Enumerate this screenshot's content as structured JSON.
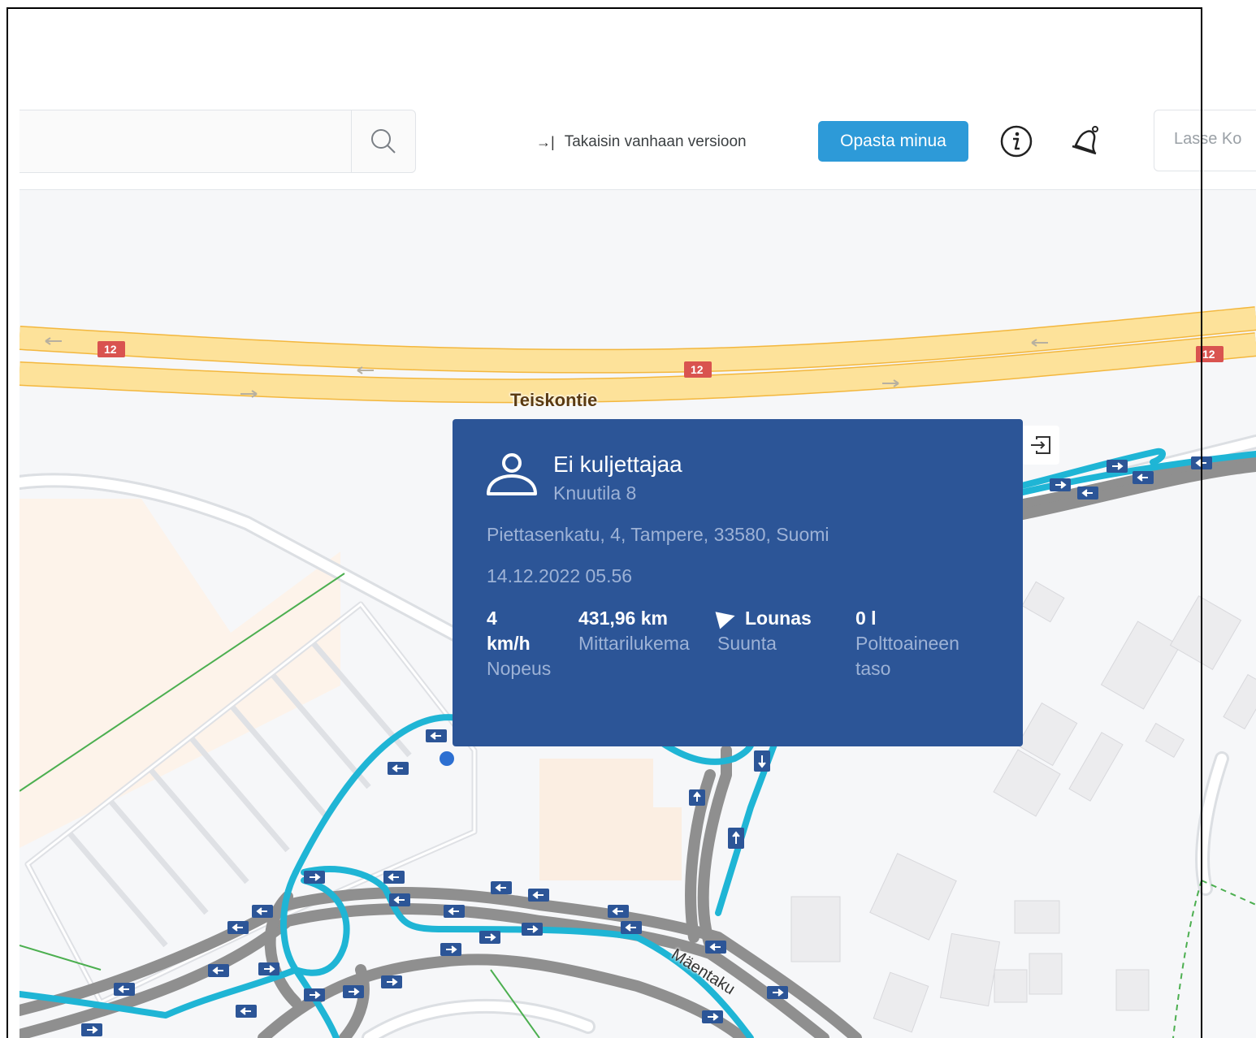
{
  "toolbar": {
    "back_link": "Takaisin vanhaan versioon",
    "guide_button": "Opasta minua",
    "user_name": "Lasse Ko"
  },
  "map": {
    "road_name": "Teiskontie",
    "road_number": "12",
    "street_name": "Mäentaku"
  },
  "popup": {
    "driver": "Ei kuljettajaa",
    "vehicle": "Knuutila 8",
    "address": "Piettasenkatu, 4, Tampere, 33580, Suomi",
    "datetime": "14.12.2022 05.56",
    "stats": [
      {
        "value": "4 km/h",
        "label": "Nopeus"
      },
      {
        "value": "431,96 km",
        "label": "Mittarilukema"
      },
      {
        "value": "Lounas",
        "label": "Suunta",
        "icon": "direction-arrow-icon"
      },
      {
        "value": "0 l",
        "label": "Polttoaineen taso"
      }
    ]
  },
  "colors": {
    "popup_bg": "#2c5597",
    "accent": "#2d9ad8",
    "route_active": "#1fb5d5",
    "route_history": "#8f8f8f",
    "highway": "#fde29a"
  }
}
